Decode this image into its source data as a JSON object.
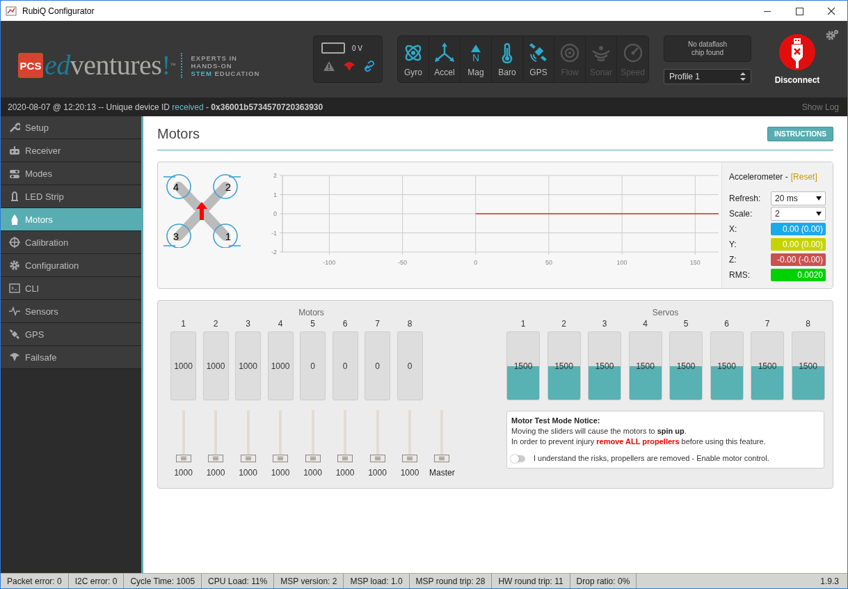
{
  "window": {
    "title": "RubiQ Configurator"
  },
  "header": {
    "logo": {
      "badge": "PCS",
      "prefix": "ed",
      "name": "ventures",
      "exclaim": "!",
      "trademark": "™",
      "tagline": [
        "EXPERTS IN",
        "HANDS-ON"
      ],
      "tagline_highlight": "STEM",
      "tagline_end": "EDUCATION"
    },
    "battery": {
      "reading": "0 V"
    },
    "sensors": [
      {
        "label": "Gyro",
        "kind": "gyro",
        "active": true
      },
      {
        "label": "Accel",
        "kind": "accel",
        "active": true
      },
      {
        "label": "Mag",
        "kind": "mag",
        "symbol": "N",
        "active": true
      },
      {
        "label": "Baro",
        "kind": "baro",
        "active": true
      },
      {
        "label": "GPS",
        "kind": "gps",
        "active": true
      },
      {
        "label": "Flow",
        "kind": "flow",
        "active": false
      },
      {
        "label": "Sonar",
        "kind": "sonar",
        "active": false
      },
      {
        "label": "Speed",
        "kind": "speed",
        "active": false
      }
    ],
    "dataflash": "No dataflash chip found",
    "profile": "Profile 1",
    "connect_button": "Disconnect"
  },
  "log": {
    "prefix": "2020-08-07 @ 12:20:13 -- Unique device ID",
    "status": "received",
    "separator": "-",
    "device_id": "0x36001b5734570720363930",
    "show_log": "Show Log"
  },
  "sidebar": {
    "items": [
      {
        "label": "Setup",
        "kind": "wrench",
        "selected": false
      },
      {
        "label": "Receiver",
        "kind": "receiver",
        "selected": false
      },
      {
        "label": "Modes",
        "kind": "modes",
        "selected": false
      },
      {
        "label": "LED Strip",
        "kind": "led",
        "selected": false
      },
      {
        "label": "Motors",
        "kind": "motors",
        "selected": true
      },
      {
        "label": "Calibration",
        "kind": "calibration",
        "selected": false
      },
      {
        "label": "Configuration",
        "kind": "configuration",
        "selected": false
      },
      {
        "label": "CLI",
        "kind": "cli",
        "selected": false
      },
      {
        "label": "Sensors",
        "kind": "sensors",
        "selected": false
      },
      {
        "label": "GPS",
        "kind": "gps",
        "selected": false
      },
      {
        "label": "Failsafe",
        "kind": "failsafe",
        "selected": false
      }
    ]
  },
  "page": {
    "title": "Motors",
    "instructions_button": "INSTRUCTIONS"
  },
  "motor_diagram": {
    "motor_numbers": [
      "4",
      "2",
      "3",
      "1"
    ]
  },
  "chart_data": {
    "type": "line",
    "grid": true,
    "x": [
      0,
      166
    ],
    "series": [
      {
        "color": "#cc3333",
        "values": [
          0,
          0
        ]
      }
    ],
    "xlim": [
      -132,
      166
    ],
    "ylim": [
      -2,
      2
    ],
    "xticks": [
      -100,
      -50,
      0,
      50,
      100,
      150
    ],
    "yticks": [
      -2,
      -1,
      0,
      1,
      2
    ]
  },
  "accelerometer": {
    "title": "Accelerometer -",
    "reset": "[Reset]",
    "refresh": {
      "label": "Refresh:",
      "value": "20 ms"
    },
    "scale": {
      "label": "Scale:",
      "value": "2"
    },
    "readings": [
      {
        "label": "X:",
        "value": "0.00 (0.00)",
        "color": "#1ba9ea"
      },
      {
        "label": "Y:",
        "value": "0.00 (0.00)",
        "color": "#c5d400"
      },
      {
        "label": "Z:",
        "value": "-0.00 (-0.00)",
        "color": "#c9514f"
      },
      {
        "label": "RMS:",
        "value": "0.0020",
        "color": "#00d200"
      }
    ]
  },
  "motors": {
    "title": "Motors",
    "channels": [
      {
        "number": "1",
        "meter": {
          "value": "1000"
        },
        "slider": {
          "value": "1000",
          "level": 0
        }
      },
      {
        "number": "2",
        "meter": {
          "value": "1000"
        },
        "slider": {
          "value": "1000",
          "level": 0
        }
      },
      {
        "number": "3",
        "meter": {
          "value": "1000"
        },
        "slider": {
          "value": "1000",
          "level": 0
        }
      },
      {
        "number": "4",
        "meter": {
          "value": "1000"
        },
        "slider": {
          "value": "1000",
          "level": 0
        }
      },
      {
        "number": "5",
        "meter": {
          "value": "0"
        },
        "slider": {
          "value": "1000",
          "level": 0
        }
      },
      {
        "number": "6",
        "meter": {
          "value": "0"
        },
        "slider": {
          "value": "1000",
          "level": 0
        }
      },
      {
        "number": "7",
        "meter": {
          "value": "0"
        },
        "slider": {
          "value": "1000",
          "level": 0
        }
      },
      {
        "number": "8",
        "meter": {
          "value": "0"
        },
        "slider": {
          "value": "1000",
          "level": 0
        }
      }
    ],
    "master": {
      "label": "Master",
      "slider": {
        "level": 0
      }
    }
  },
  "servos": {
    "title": "Servos",
    "channels": [
      {
        "number": "1",
        "value": "1500",
        "level": 0.5
      },
      {
        "number": "2",
        "value": "1500",
        "level": 0.5
      },
      {
        "number": "3",
        "value": "1500",
        "level": 0.5
      },
      {
        "number": "4",
        "value": "1500",
        "level": 0.5
      },
      {
        "number": "5",
        "value": "1500",
        "level": 0.5
      },
      {
        "number": "6",
        "value": "1500",
        "level": 0.5
      },
      {
        "number": "7",
        "value": "1500",
        "level": 0.5
      },
      {
        "number": "8",
        "value": "1500",
        "level": 0.5
      }
    ]
  },
  "notice": {
    "title": "Motor Test Mode Notice:",
    "lines": [
      {
        "text": "Moving the sliders will cause the motors to **spin up**.",
        "kind": "plain"
      },
      {
        "text": "In order to prevent injury **remove ALL propellers** before using this feature.",
        "kind": "warning"
      }
    ],
    "toggle": {
      "label": "I understand the risks, propellers are removed - Enable motor control.",
      "on": false
    }
  },
  "status_bar": {
    "items": [
      "Packet error: 0",
      "I2C error: 0",
      "Cycle Time: 1005",
      "CPU Load: 11%",
      "MSP version: 2",
      "MSP load: 1.0",
      "MSP round trip: 28",
      "HW round trip: 11",
      "Drop ratio: 0%"
    ],
    "version": "1.9.3"
  }
}
